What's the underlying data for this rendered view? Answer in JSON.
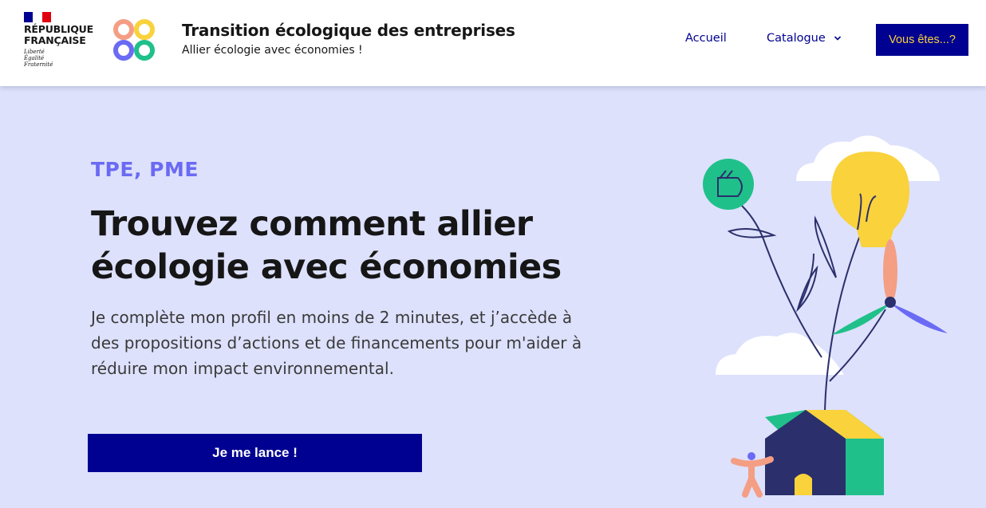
{
  "header": {
    "republique_line1": "RÉPUBLIQUE",
    "republique_line2": "FRANÇAISE",
    "motto": [
      "Liberté",
      "Égalité",
      "Fraternité"
    ],
    "site_title": "Transition écologique des entreprises",
    "site_tagline": "Allier écologie avec économies !",
    "nav": {
      "accueil": "Accueil",
      "catalogue": "Catalogue"
    },
    "cta_label": "Vous êtes...?"
  },
  "hero": {
    "kicker": "TPE, PME",
    "headline": "Trouvez comment allier écologie avec économies",
    "lead": "Je complète mon profil en moins de 2 minutes, et j’accède à des propositions d’actions et de financements pour m'aider à réduire mon impact environnemental.",
    "cta_label": "Je me lance !"
  },
  "colors": {
    "brand_blue": "#000091",
    "hero_bg": "#dde1fc",
    "kicker": "#6a6af4",
    "accent_yellow": "#f9d23c",
    "green": "#20c08a",
    "salmon": "#f49e84"
  },
  "icons": [
    "marianne-logo",
    "fete-logo",
    "chevron-down-icon",
    "plant-illustration"
  ]
}
